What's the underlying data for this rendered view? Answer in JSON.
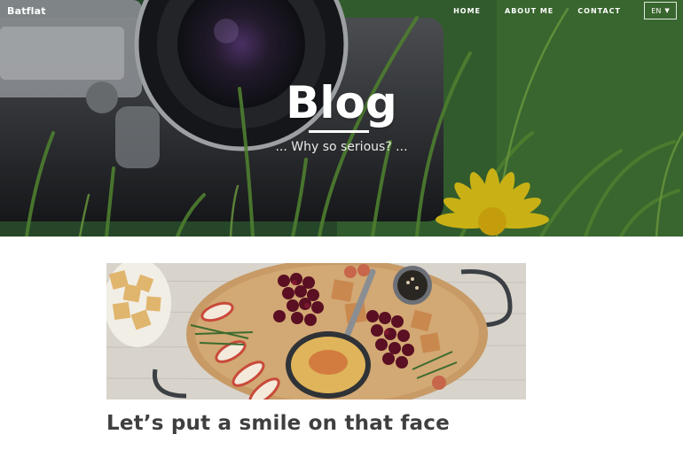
{
  "site": {
    "brand": "Batflat"
  },
  "nav": {
    "items": [
      {
        "label": "HOME"
      },
      {
        "label": "ABOUT ME"
      },
      {
        "label": "CONTACT"
      }
    ],
    "language": {
      "selected": "EN",
      "caret_icon": "caret-down-icon"
    }
  },
  "hero": {
    "title": "Blog",
    "subtitle": "... Why so serious? ..."
  },
  "post": {
    "title": "Let’s put a smile on that face"
  },
  "colors": {
    "title_text": "#3f3f3f",
    "white": "#ffffff",
    "hero_green": "#3e6e33",
    "flower_yellow": "#f6d81a"
  }
}
